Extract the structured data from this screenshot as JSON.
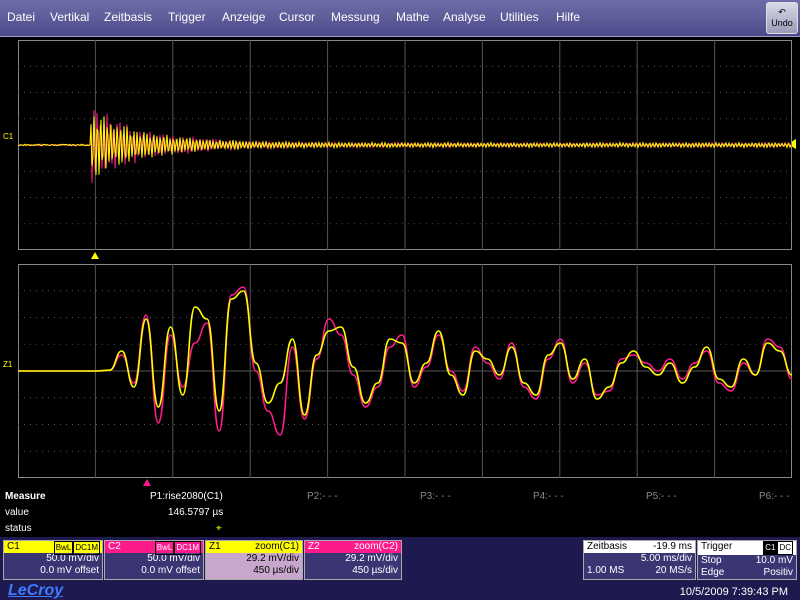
{
  "menu": [
    "Datei",
    "Vertikal",
    "Zeitbasis",
    "Trigger",
    "Anzeige",
    "Cursor",
    "Messung",
    "Mathe",
    "Analyse",
    "Utilities",
    "Hilfe"
  ],
  "undo_label": "Undo",
  "channel_labels": {
    "top_left": "C1",
    "bottom_left": "Z1"
  },
  "measure": {
    "title": "Measure",
    "row_value": "value",
    "row_status": "status",
    "p1_label": "P1:rise2080(C1)",
    "p1_value": "146.5797 µs",
    "p1_status": "⌖",
    "p2": "P2:- - -",
    "p3": "P3:- - -",
    "p4": "P4:- - -",
    "p5": "P5:- - -",
    "p6": "P6:- - -"
  },
  "c1": {
    "name": "C1",
    "tag1": "BwL",
    "tag2": "DC1M",
    "vdiv": "50.0 mV/div",
    "offset": "0.0 mV offset"
  },
  "c2": {
    "name": "C2",
    "tag1": "BwL",
    "tag2": "DC1M",
    "vdiv": "50.0 mV/div",
    "offset": "0.0 mV offset"
  },
  "z1": {
    "name": "Z1",
    "src": "zoom(C1)",
    "vdiv": "29.2 mV/div",
    "tdiv": "450 µs/div"
  },
  "z2": {
    "name": "Z2",
    "src": "zoom(C2)",
    "vdiv": "29.2 mV/div",
    "tdiv": "450 µs/div"
  },
  "timebase": {
    "title": "Zeitbasis",
    "delay": "-19.9 ms",
    "div": "5.00 ms/div",
    "samples": "1.00 MS",
    "rate": "20 MS/s"
  },
  "trigger": {
    "title": "Trigger",
    "tag1": "C1",
    "tag2": "DC",
    "mode": "Stop",
    "level": "10.0 mV",
    "type": "Edge",
    "slope": "Positiv"
  },
  "brand": "LeCroy",
  "datetime": "10/5/2009 7:39:43 PM",
  "colors": {
    "c1": "#ffff00",
    "c2": "#ff1a8c",
    "z1": "#ffff00",
    "z2": "#ff1a8c",
    "grid": "#555555"
  },
  "chart_data": {
    "type": "line",
    "series": [
      {
        "values": [
          0,
          0,
          0,
          0.01,
          0.25,
          -0.2,
          0.65,
          -0.45,
          0.55,
          -0.3,
          0.8,
          0.65,
          -0.5,
          0.9,
          1.0,
          0.1,
          -0.4,
          -0.15,
          0.4,
          -0.55,
          0.2,
          0.5,
          0.55,
          0.05,
          -0.4,
          -0.15,
          0.4,
          0.35,
          -0.15,
          0.1,
          0.5,
          -0.05,
          -0.3,
          0.25,
          0.15,
          -0.05,
          0.3,
          -0.15,
          -0.3,
          0.2,
          0.35,
          -0.1,
          0.15,
          -0.35,
          -0.2,
          0.1,
          0.25,
          0.05,
          -0.05,
          0.1,
          -0.15,
          0.05,
          0.3,
          -0.1,
          -0.2,
          0.15,
          -0.05,
          0.35,
          0.25,
          -0.05
        ]
      },
      {
        "values": [
          0,
          0,
          0,
          0.01,
          0.2,
          -0.15,
          0.7,
          -0.65,
          0.45,
          -0.2,
          0.35,
          0.6,
          -0.75,
          0.95,
          1.05,
          0.0,
          -0.5,
          -0.8,
          0.3,
          -0.6,
          0.15,
          0.65,
          0.45,
          -0.05,
          -0.45,
          -0.2,
          0.3,
          0.45,
          -0.2,
          0.05,
          0.45,
          0.0,
          -0.25,
          0.3,
          0.1,
          -0.1,
          0.35,
          -0.2,
          -0.35,
          0.15,
          0.4,
          -0.15,
          0.1,
          -0.3,
          -0.25,
          0.15,
          0.2,
          0.1,
          0.0,
          0.15,
          -0.1,
          0.1,
          0.25,
          -0.15,
          -0.25,
          0.1,
          -0.05,
          0.4,
          0.3,
          -0.1
        ]
      }
    ]
  }
}
